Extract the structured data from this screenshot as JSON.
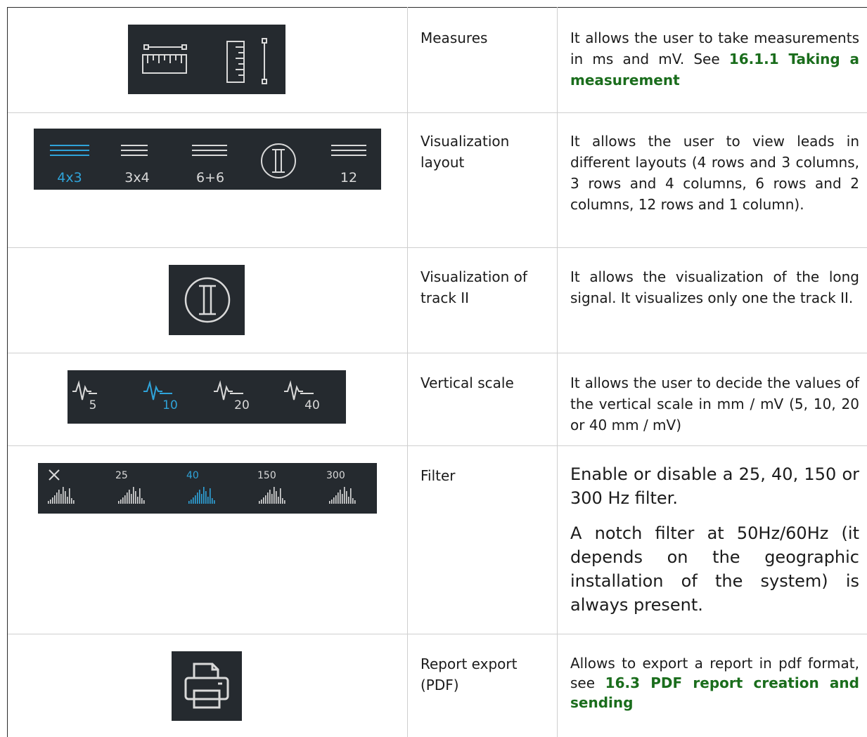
{
  "rows": [
    {
      "name": "Measures",
      "desc": "It allows the user to take measurements in ms and mV. See ",
      "link": "16.1.1 Taking a measurement",
      "icons": [
        "ruler-horizontal-icon",
        "ruler-vertical-icon"
      ]
    },
    {
      "name": "Visualization layout",
      "desc": "It allows the user to view leads in different layouts (4 rows and 3 columns, 3 rows and 4 columns, 6 rows and 2 columns, 12 rows and 1 column).",
      "layouts": [
        "4x3",
        "3x4",
        "6+6",
        "12"
      ],
      "active_layout": "4x3"
    },
    {
      "name": "Visualization of track II",
      "desc": "It allows the visualization of the long signal. It visualizes only one the track II."
    },
    {
      "name": "Vertical scale",
      "desc": "It allows the user to decide the values of the vertical scale in mm / mV (5, 10, 20 or 40 mm / mV)",
      "scales": [
        "5",
        "10",
        "20",
        "40"
      ],
      "active_scale": "10"
    },
    {
      "name": "Filter",
      "desc_1": "Enable or disable a 25, 40, 150 or 300 Hz filter.",
      "desc_2": "A notch filter at 50Hz/60Hz (it depends on the geographic installation of the system) is always present.",
      "filters": [
        "25",
        "40",
        "150",
        "300"
      ],
      "active_filter": "40"
    },
    {
      "name": "Report export (PDF)",
      "desc": "Allows to export a report in pdf format, see ",
      "link": "16.3 PDF report creation and sending"
    }
  ],
  "colors": {
    "panel": "#252a2f",
    "icon": "#d9d9d9",
    "active": "#2fa3d9",
    "link": "#1a6d1c"
  }
}
